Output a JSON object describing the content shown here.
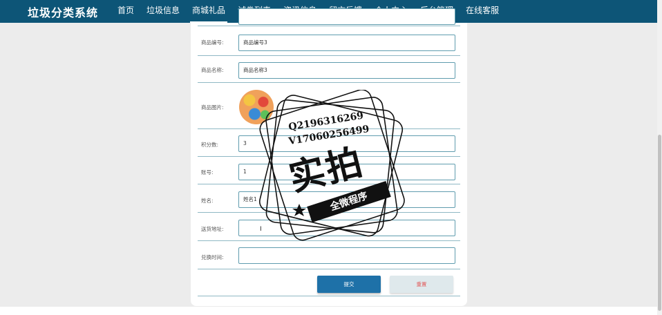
{
  "header": {
    "brand": "垃圾分类系统",
    "nav": [
      {
        "label": "首页",
        "active": false
      },
      {
        "label": "垃圾信息",
        "active": false
      },
      {
        "label": "商城礼品",
        "active": true
      },
      {
        "label": "试卷列表",
        "active": false
      },
      {
        "label": "资讯信息",
        "active": false
      },
      {
        "label": "留言反馈",
        "active": false
      },
      {
        "label": "个人中心",
        "active": false
      },
      {
        "label": "后台管理",
        "active": false
      },
      {
        "label": "在线客服",
        "active": false
      }
    ]
  },
  "form": {
    "product_code": {
      "label": "商品编号:",
      "value": "商品编号3"
    },
    "product_name": {
      "label": "商品名称:",
      "value": "商品名称3"
    },
    "product_image": {
      "label": "商品图片:"
    },
    "points": {
      "label": "积分数:",
      "value": "3"
    },
    "account": {
      "label": "账号:",
      "value": "1"
    },
    "name": {
      "label": "姓名:",
      "value": "姓名1"
    },
    "address": {
      "label": "送货地址:",
      "value": ""
    },
    "redeem_time": {
      "label": "兑换时间:",
      "value": ""
    },
    "submit_label": "提交",
    "reset_label": "重置"
  },
  "watermark": {
    "line1": "Q2196316269",
    "line2": "V17060256499",
    "big_text": "实拍",
    "banner": "全微程序"
  },
  "colors": {
    "header_bg": "#0d5577",
    "submit_bg": "#1e71a8",
    "reset_bg": "#dfe9ec"
  }
}
